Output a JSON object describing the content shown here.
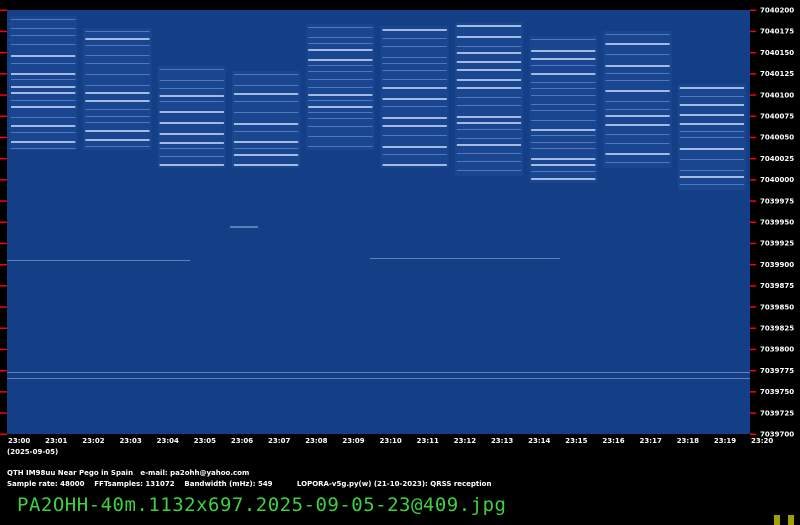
{
  "freq_labels": [
    "7040200",
    "7040175",
    "7040150",
    "7040125",
    "7040100",
    "7040075",
    "7040050",
    "7040025",
    "7040000",
    "7039975",
    "7039950",
    "7039925",
    "7039900",
    "7039875",
    "7039850",
    "7039825",
    "7039800",
    "7039775",
    "7039750",
    "7039725",
    "7039700"
  ],
  "time_labels": [
    "23:00",
    "23:01",
    "23:02",
    "23:03",
    "23:04",
    "23:05",
    "23:06",
    "23:07",
    "23:08",
    "23:09",
    "23:10",
    "23:11",
    "23:12",
    "23:13",
    "23:14",
    "23:15",
    "23:16",
    "23:17",
    "23:18",
    "23:19",
    "23:20"
  ],
  "date_label": "(2025-09-05)",
  "info": {
    "line1": "QTH IM98uu Near Pego in Spain   e-mail: pa2ohh@yahoo.com",
    "line2": "Sample rate: 48000    FFTsamples: 131072    Bandwidth (mHz): 549          LOPORA-v5g.py(w) (21-10-2023): QRSS reception"
  },
  "filename": "PA2OHH-40m.1132x697.2025-09-05-23@409.jpg",
  "colors": {
    "background": "#000000",
    "waterfall": "#10408a",
    "tick": "#ff0000",
    "filename": "#3cd23c"
  }
}
